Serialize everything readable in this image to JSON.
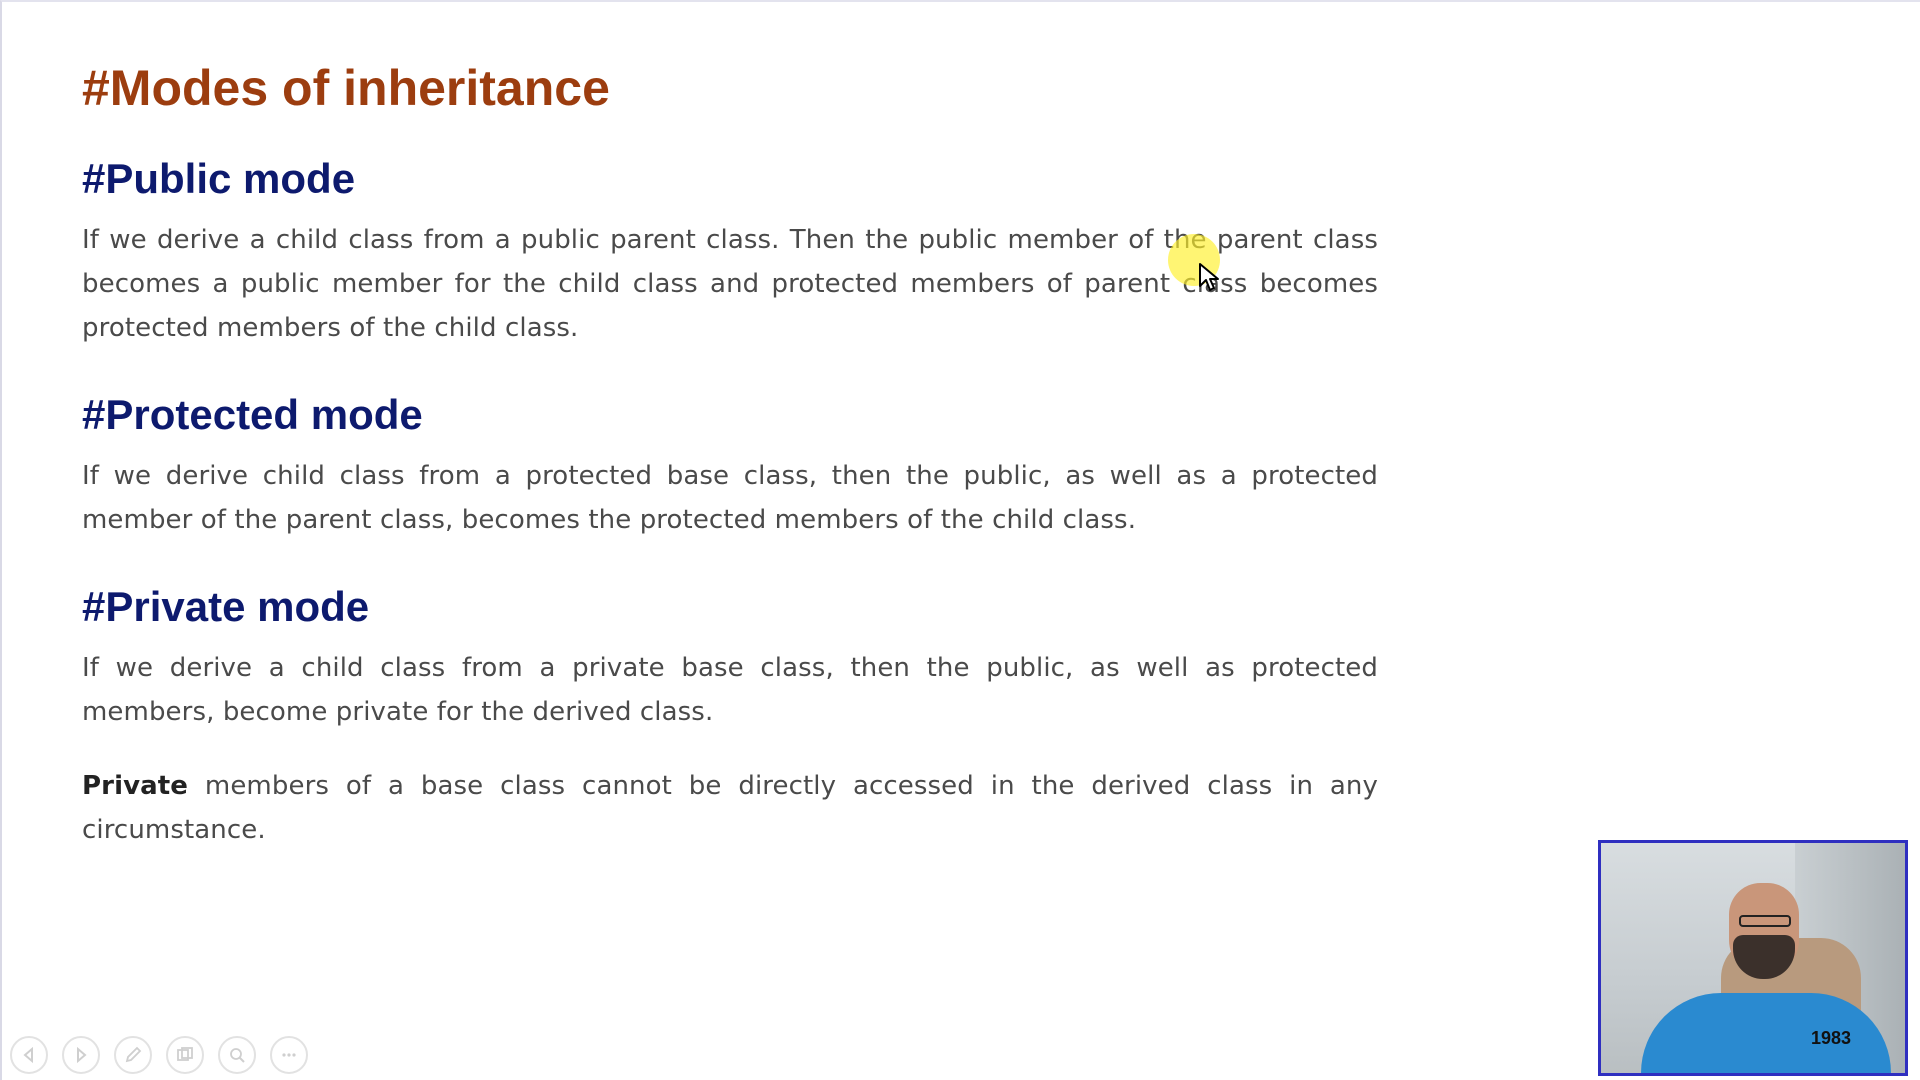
{
  "slide": {
    "title": "#Modes of inheritance",
    "sections": [
      {
        "heading": "#Public mode",
        "paragraph": "If we derive a child class from a public parent class. Then the public member of the parent class becomes a public member for the child class and protected members of parent class becomes protected members of the child class."
      },
      {
        "heading": "#Protected mode",
        "paragraph": "If we derive child class from a protected base class, then the public, as well as a protected member of the parent class, becomes the protected members of the child class."
      },
      {
        "heading": "#Private mode",
        "paragraph": "If we derive a child class from a private base class, then the public, as well as protected members, become private for the derived class.",
        "note_bold": "Private",
        "note_rest": " members of a base class cannot be directly accessed in the derived class in any circumstance."
      }
    ]
  },
  "webcam": {
    "shirt_text": "1983"
  },
  "controls": {
    "icons": [
      "prev-icon",
      "next-icon",
      "pen-icon",
      "slides-icon",
      "zoom-icon",
      "more-icon"
    ]
  }
}
